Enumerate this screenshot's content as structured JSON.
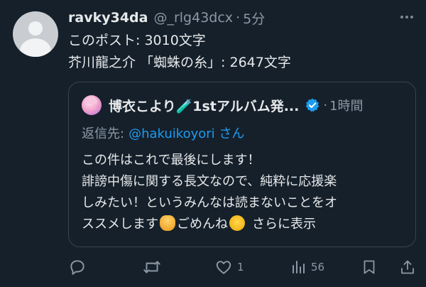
{
  "post": {
    "display_name": "ravky34da",
    "handle": "@_rlg43dcx",
    "separator": "·",
    "time": "5分",
    "lines": [
      "このポスト: 3010文字",
      "芥川龍之介 「蜘蛛の糸」: 2647文字"
    ]
  },
  "quote": {
    "display_name": "博衣こより🧪1stアルバム発...",
    "separator": "·",
    "time": "1時間",
    "reply_label": "返信先:",
    "reply_user": "@hakuikoyori さん",
    "lines": [
      "この件はこれで最後にします！",
      "誹謗中傷に関する長文なので、純粋に応援楽",
      "しみたい！というみんなは読まないことをオ"
    ],
    "last_line_a": "ススメします",
    "last_line_b": "ごめんね",
    "show_more": "さらに表示"
  },
  "actions": {
    "reply_count": "",
    "repost_count": "",
    "like_count": "1",
    "views_count": "56"
  },
  "colors": {
    "background": "#15202b",
    "text": "#e7e9ea",
    "muted": "#8b98a5",
    "accent": "#1d9bf0",
    "border": "#38444d"
  },
  "icons": [
    "more-icon",
    "verified-badge-icon",
    "reply-icon",
    "repost-icon",
    "like-icon",
    "views-icon",
    "bookmark-icon",
    "share-icon",
    "pray-emoji",
    "crying-emoji"
  ]
}
